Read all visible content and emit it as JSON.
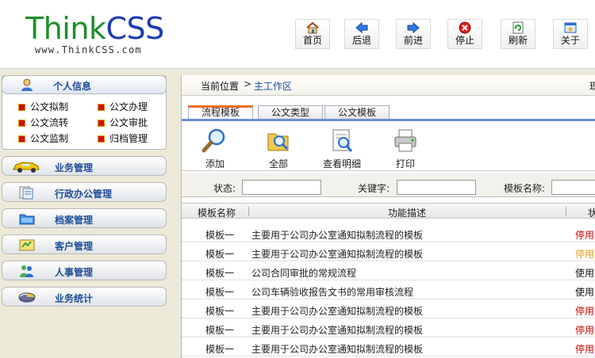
{
  "header": {
    "logo_think": "Think",
    "logo_css": "CSS",
    "logo_sub": "www.ThinkCSS.com",
    "buttons": [
      {
        "label": "首页",
        "icon": "home-icon"
      },
      {
        "label": "后退",
        "icon": "back-arrow-icon"
      },
      {
        "label": "前进",
        "icon": "forward-arrow-icon"
      },
      {
        "label": "停止",
        "icon": "stop-icon"
      },
      {
        "label": "刷新",
        "icon": "refresh-icon"
      },
      {
        "label": "关于",
        "icon": "about-icon"
      }
    ]
  },
  "sidebar": {
    "personal_title": "个人信息",
    "personal_items": [
      "公文拟制",
      "公文办理",
      "公文流转",
      "公文审批",
      "公文监制",
      "归档管理"
    ],
    "menus": [
      {
        "label": "业务管理",
        "icon": "car-icon"
      },
      {
        "label": "行政办公管理",
        "icon": "documents-icon"
      },
      {
        "label": "档案管理",
        "icon": "folder-icon"
      },
      {
        "label": "客户管理",
        "icon": "customer-icon"
      },
      {
        "label": "人事管理",
        "icon": "people-icon"
      },
      {
        "label": "业务统计",
        "icon": "pie-chart-icon"
      }
    ]
  },
  "breadcrumb": {
    "label": "当前位置",
    "separator": ">",
    "current": "主工作区",
    "edge_text": "现"
  },
  "tabs": [
    "流程模板",
    "公文类型",
    "公文模板"
  ],
  "active_tab": 0,
  "tools": [
    {
      "label": "添加",
      "icon": "magnifier-icon"
    },
    {
      "label": "全部",
      "icon": "folder-search-icon"
    },
    {
      "label": "查看明细",
      "icon": "view-detail-icon"
    },
    {
      "label": "打印",
      "icon": "printer-icon"
    }
  ],
  "search": {
    "status_label": "状态:",
    "status_value": "",
    "keyword_label": "关键字:",
    "keyword_value": "",
    "template_label": "模板名称:",
    "template_value": ""
  },
  "table": {
    "columns": [
      "模板名称",
      "功能描述",
      "状"
    ],
    "rows": [
      {
        "name": "模板一",
        "desc": "主要用于公司办公室通知拟制流程的模板",
        "status": "停用",
        "color": "#d00000"
      },
      {
        "name": "模板一",
        "desc": "主要用于公司办公室通知拟制流程的模板",
        "status": "停用",
        "color": "#e39a12"
      },
      {
        "name": "模板一",
        "desc": "公司合同审批的常规流程",
        "status": "使用",
        "color": "#111111"
      },
      {
        "name": "模板一",
        "desc": "公司车辆验收报告文书的常用审核流程",
        "status": "使用",
        "color": "#111111"
      },
      {
        "name": "模板一",
        "desc": "主要用于公司办公室通知拟制流程的模板",
        "status": "停用",
        "color": "#d00000"
      },
      {
        "name": "模板一",
        "desc": "主要用于公司办公室通知拟制流程的模板",
        "status": "停用",
        "color": "#d00000"
      },
      {
        "name": "模板一",
        "desc": "主要用于公司办公室通知拟制流程的模板",
        "status": "停用",
        "color": "#d00000"
      }
    ]
  },
  "colors": {
    "accent": "#1e4d9a",
    "tab_active": "#ee6b1a",
    "disabled_status": "#d00000"
  }
}
